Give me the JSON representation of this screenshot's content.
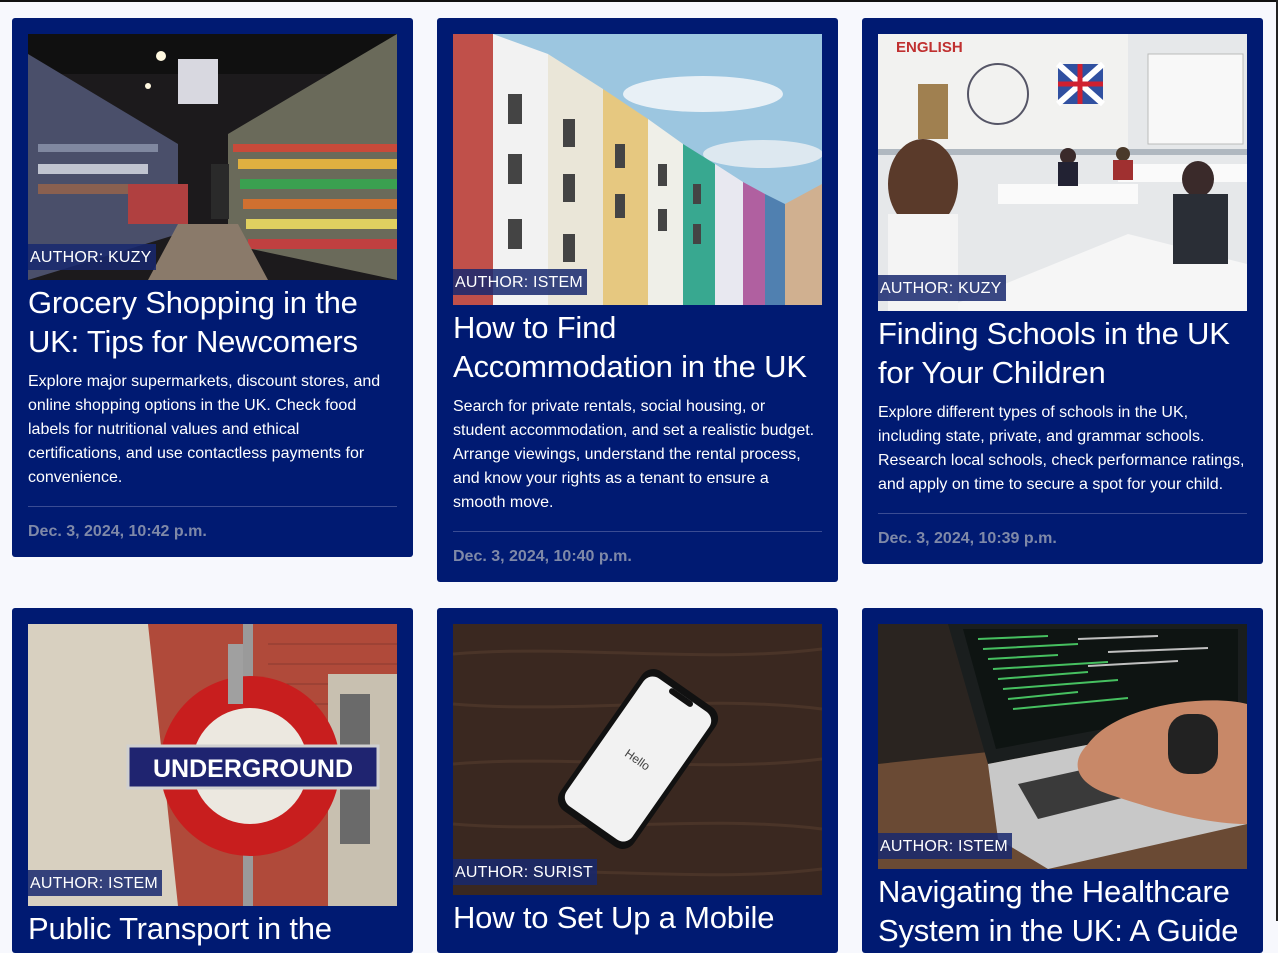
{
  "cards": [
    {
      "author": "AUTHOR: KUZY",
      "title": "Grocery Shopping in the UK: Tips for Newcomers",
      "description": "Explore major supermarkets, discount stores, and online shopping options in the UK. Check food labels for nutritional values and ethical certifications, and use contactless payments for convenience.",
      "date": "Dec. 3, 2024, 10:42 p.m."
    },
    {
      "author": "AUTHOR: ISTEM",
      "title": "How to Find Accommodation in the UK",
      "description": "Search for private rentals, social housing, or student accommodation, and set a realistic budget. Arrange viewings, understand the rental process, and know your rights as a tenant to ensure a smooth move.",
      "date": "Dec. 3, 2024, 10:40 p.m."
    },
    {
      "author": "AUTHOR: KUZY",
      "title": "Finding Schools in the UK for Your Children",
      "description": "Explore different types of schools in the UK, including state, private, and grammar schools. Research local schools, check performance ratings, and apply on time to secure a spot for your child.",
      "date": "Dec. 3, 2024, 10:39 p.m."
    },
    {
      "author": "AUTHOR: ISTEM",
      "title": "Public Transport in the",
      "sign_text": "UNDERGROUND"
    },
    {
      "author": "AUTHOR: SURIST",
      "title": "How to Set Up a Mobile",
      "phone_text": "Hello"
    },
    {
      "author": "AUTHOR: ISTEM",
      "title": "Navigating the Healthcare System in the UK: A Guide"
    }
  ],
  "mural_text": "ENGLISH"
}
